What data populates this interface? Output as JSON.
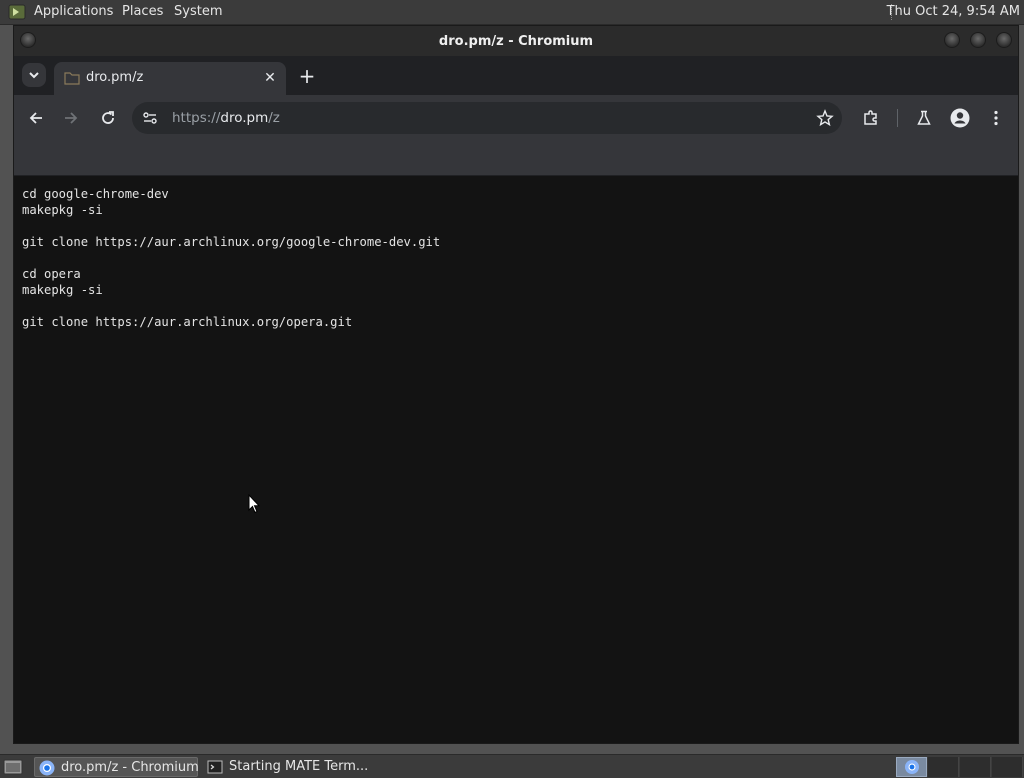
{
  "top_panel": {
    "menus": [
      "Applications",
      "Places",
      "System"
    ],
    "clock": "Thu Oct 24,  9:54 AM"
  },
  "window": {
    "title": "dro.pm/z - Chromium"
  },
  "browser": {
    "tab": {
      "title": "dro.pm/z",
      "close_symbol": "✕"
    },
    "new_tab_symbol": "+",
    "omnibox": {
      "scheme": "https://",
      "host": "dro.pm",
      "path": "/z"
    }
  },
  "page": {
    "text": "cd google-chrome-dev\nmakepkg -si\n\ngit clone https://aur.archlinux.org/google-chrome-dev.git\n\ncd opera\nmakepkg -si\n\ngit clone https://aur.archlinux.org/opera.git"
  },
  "taskbar": {
    "tasks": [
      {
        "label": "dro.pm/z - Chromium",
        "icon": "chromium-icon",
        "active": true
      },
      {
        "label": "Starting MATE Term...",
        "icon": "terminal-icon",
        "active": false
      }
    ],
    "workspaces": 4,
    "current_workspace": 1
  },
  "colors": {
    "page_background": "#131313",
    "page_text": "#e4e4e4",
    "toolbar": "#35363a",
    "panel": "#3b3b3b"
  }
}
